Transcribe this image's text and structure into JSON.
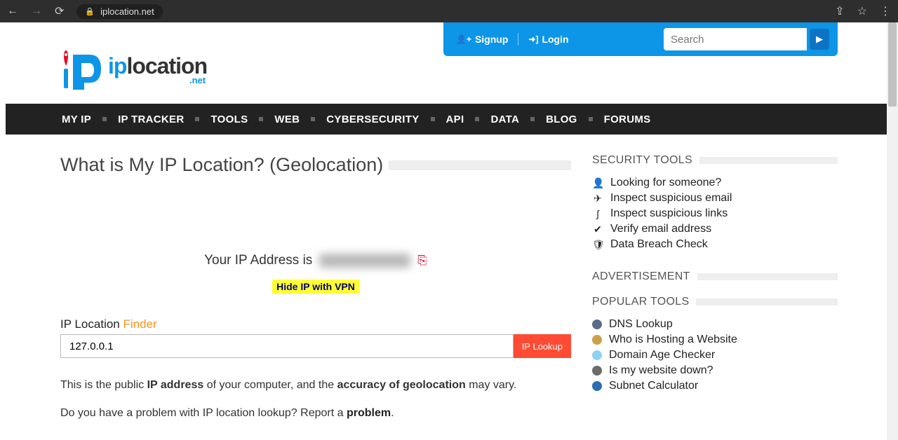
{
  "browser": {
    "url": "iplocation.net"
  },
  "topbar": {
    "signup": "Signup",
    "login": "Login",
    "search_placeholder": "Search"
  },
  "logo": {
    "text_location": "location",
    "sub": ".net"
  },
  "nav": {
    "items": [
      "MY IP",
      "IP TRACKER",
      "TOOLS",
      "WEB",
      "CYBERSECURITY",
      "API",
      "DATA",
      "BLOG",
      "FORUMS"
    ]
  },
  "main": {
    "title": "What is My IP Location? (Geolocation)",
    "ip_label": "Your IP Address is",
    "hide_vpn": "Hide IP with VPN",
    "finder_label": "IP Location",
    "finder_accent": "Finder",
    "finder_value": "127.0.0.1",
    "lookup_btn": "IP Lookup",
    "para1_a": "This is the public ",
    "para1_b": "IP address",
    "para1_c": " of your computer, and the ",
    "para1_d": "accuracy of geolocation",
    "para1_e": " may vary.",
    "para2_a": "Do you have a problem with IP location lookup? Report a ",
    "para2_b": "problem",
    "para2_c": "."
  },
  "side": {
    "sec_head": "SECURITY TOOLS",
    "sec_items": [
      {
        "icon": "person",
        "label": "Looking for someone?"
      },
      {
        "icon": "send",
        "label": "Inspect suspicious email"
      },
      {
        "icon": "hook",
        "label": "Inspect suspicious links"
      },
      {
        "icon": "check",
        "label": "Verify email address"
      },
      {
        "icon": "shield",
        "label": "Data Breach Check"
      }
    ],
    "ad_head": "ADVERTISEMENT",
    "pop_head": "POPULAR TOOLS",
    "pop_items": [
      {
        "color": "#5b6d8a",
        "label": "DNS Lookup"
      },
      {
        "color": "#c9a24a",
        "label": "Who is Hosting a Website"
      },
      {
        "color": "#8fd3f4",
        "label": "Domain Age Checker"
      },
      {
        "color": "#6b6b6b",
        "label": "Is my website down?"
      },
      {
        "color": "#2a6fb5",
        "label": "Subnet Calculator"
      }
    ]
  }
}
